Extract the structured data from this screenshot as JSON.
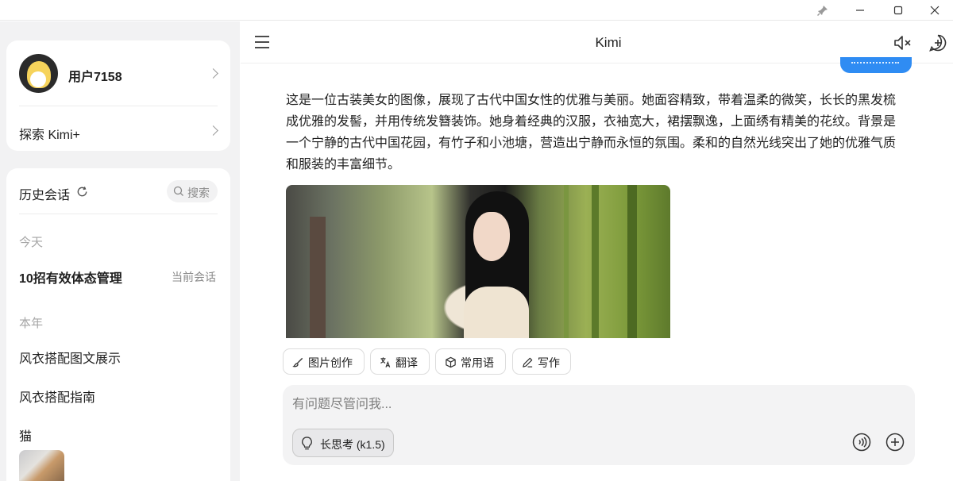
{
  "window": {
    "controls": {
      "pin": "pin-icon",
      "minimize": "minimize-icon",
      "maximize": "maximize-icon",
      "close": "close-icon"
    }
  },
  "sidebar": {
    "profile": {
      "username": "用户7158",
      "avatar": "user-avatar"
    },
    "explore_label": "探索 Kimi+",
    "history": {
      "title": "历史会话",
      "search_label": "搜索",
      "sections": [
        {
          "label": "今天",
          "items": [
            {
              "title": "10招有效体态管理",
              "tag": "当前会话"
            }
          ]
        },
        {
          "label": "本年",
          "items": [
            {
              "title": "风衣搭配图文展示"
            },
            {
              "title": "风衣搭配指南"
            },
            {
              "title": "猫"
            }
          ]
        }
      ]
    }
  },
  "main": {
    "title": "Kimi",
    "answer": "这是一位古装美女的图像，展现了古代中国女性的优雅与美丽。她面容精致，带着温柔的微笑，长长的黑发梳\n成优雅的发髻，并用传统发簪装饰。她身着经典的汉服，衣袖宽大，裙摆飘逸，上面绣有精美的花纹。背景是\n一个宁静的古代中国花园，有竹子和小池塘，营造出宁静而永恒的氛围。柔和的自然光线突出了她的优雅气质\n和服装的丰富细节。",
    "chips": [
      {
        "label": "图片创作",
        "icon": "brush-icon"
      },
      {
        "label": "翻译",
        "icon": "translate-icon"
      },
      {
        "label": "常用语",
        "icon": "cube-icon"
      },
      {
        "label": "写作",
        "icon": "pen-icon"
      }
    ],
    "composer": {
      "placeholder": "有问题尽管问我...",
      "value": "",
      "think_label": "长思考 (k1.5)"
    }
  },
  "colors": {
    "accent": "#2f8cf3",
    "sidebar_bg": "#f2f2f3",
    "composer_bg": "#f3f3f4"
  }
}
